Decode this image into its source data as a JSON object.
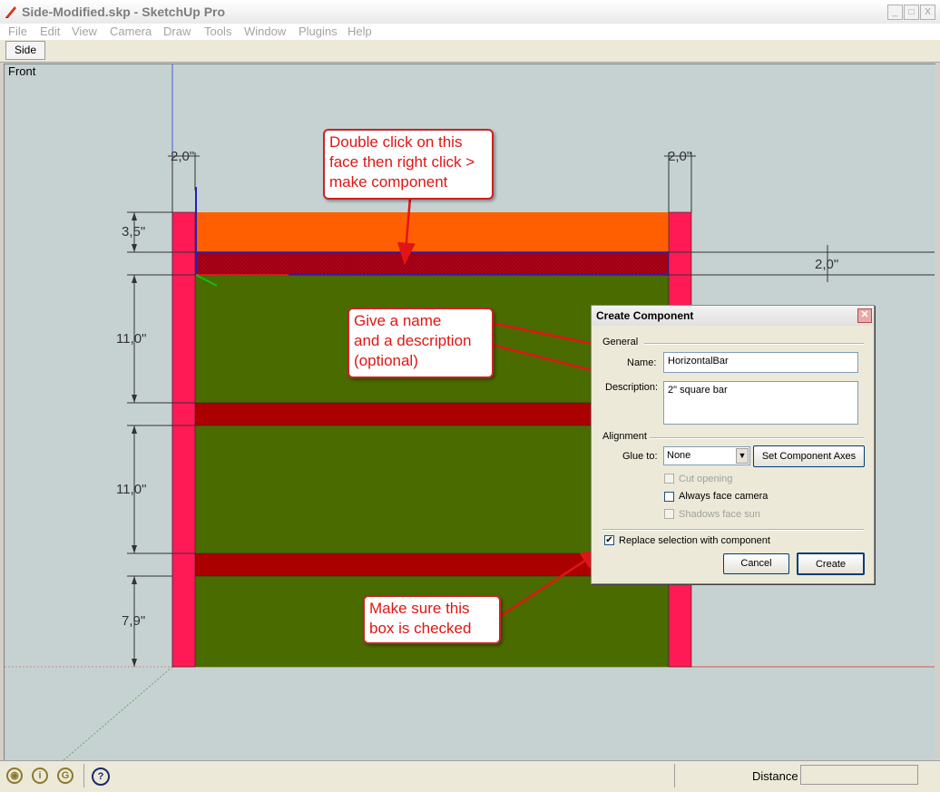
{
  "app": {
    "title": "Side-Modified.skp - SketchUp Pro",
    "icon": "sketchup-pencil-icon",
    "window_buttons": [
      "_",
      "□",
      "X"
    ]
  },
  "menu": [
    "File",
    "Edit",
    "View",
    "Camera",
    "Draw",
    "Tools",
    "Window",
    "Plugins",
    "Help"
  ],
  "scene_tab": "Side",
  "viewport": {
    "view_label": "Front",
    "dimensions": {
      "left_width": "2,0\"",
      "right_width": "2,0\"",
      "top_height": "3,5\"",
      "bar_height": "2,0\"",
      "gap_upper": "11,0\"",
      "gap_middle": "11,0\"",
      "gap_lower": "7,9\""
    },
    "colors": {
      "background": "#c6d2d2",
      "post": "#ff1a56",
      "top_rail": "#ff5f00",
      "bar": "#aa0000",
      "panel": "#4a6b00",
      "selected_bar": "#b00018",
      "annotation": "#e01515"
    }
  },
  "callouts": {
    "face": [
      "Double click on this",
      "face then right click >",
      "make component"
    ],
    "name": [
      "Give a name",
      "and a description",
      "(optional)"
    ],
    "checkbox": [
      "Make sure this",
      "box is checked"
    ]
  },
  "dialog": {
    "title": "Create Component",
    "general_label": "General",
    "name_label": "Name:",
    "name_value": "HorizontalBar",
    "description_label": "Description:",
    "description_value": "2\" square bar",
    "alignment_label": "Alignment",
    "glue_label": "Glue to:",
    "glue_value": "None",
    "set_axes_label": "Set Component Axes",
    "cut_opening_label": "Cut opening",
    "always_face_label": "Always face camera",
    "shadows_label": "Shadows face sun",
    "replace_label": "Replace selection with component",
    "replace_checked": true,
    "cancel_label": "Cancel",
    "create_label": "Create"
  },
  "statusbar": {
    "icons": [
      "geo-location-icon",
      "credits-icon",
      "user-icon",
      "help-icon"
    ],
    "distance_label": "Distance",
    "distance_value": ""
  }
}
